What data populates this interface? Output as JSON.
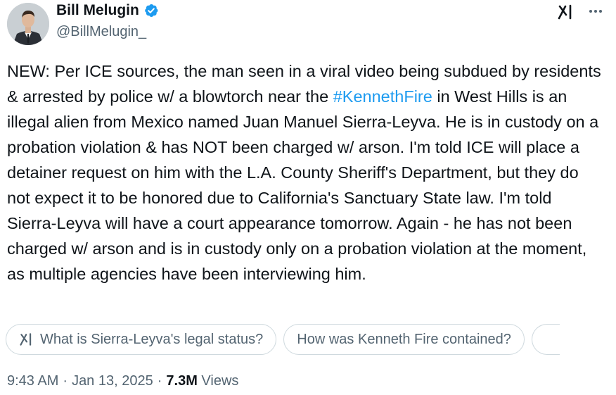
{
  "author": {
    "display_name": "Bill Melugin",
    "handle": "@BillMelugin_",
    "verified": true,
    "verified_color": "#1d9bf0"
  },
  "header_icons": [
    "grok-icon",
    "more-options-icon"
  ],
  "tweet": {
    "text_before_hashtag": "NEW: Per ICE sources, the man seen in a viral video being subdued by residents & arrested by police w/ a blowtorch near the ",
    "hashtag": "#KennethFire",
    "text_after_hashtag": " in West Hills is an illegal alien from Mexico named Juan Manuel Sierra-Leyva. He is in custody on a probation violation & has NOT been charged w/ arson. I'm told ICE will place a detainer request on him with the L.A. County Sheriff's Department, but they do not expect it to be honored due to California's Sanctuary State law. I'm told Sierra-Leyva will have a court appearance tomorrow. Again - he has not been charged w/ arson and is in custody only on a probation violation at the moment, as multiple agencies have been interviewing him.",
    "link_color": "#1d9bf0"
  },
  "grok_suggestions": [
    {
      "label": "What is Sierra-Leyva's legal status?",
      "icon": "grok-icon"
    },
    {
      "label": "How was Kenneth Fire contained?"
    }
  ],
  "meta": {
    "time": "9:43 AM",
    "separator": "·",
    "date": "Jan 13, 2025",
    "views_count": "7.3M",
    "views_label": "Views"
  }
}
